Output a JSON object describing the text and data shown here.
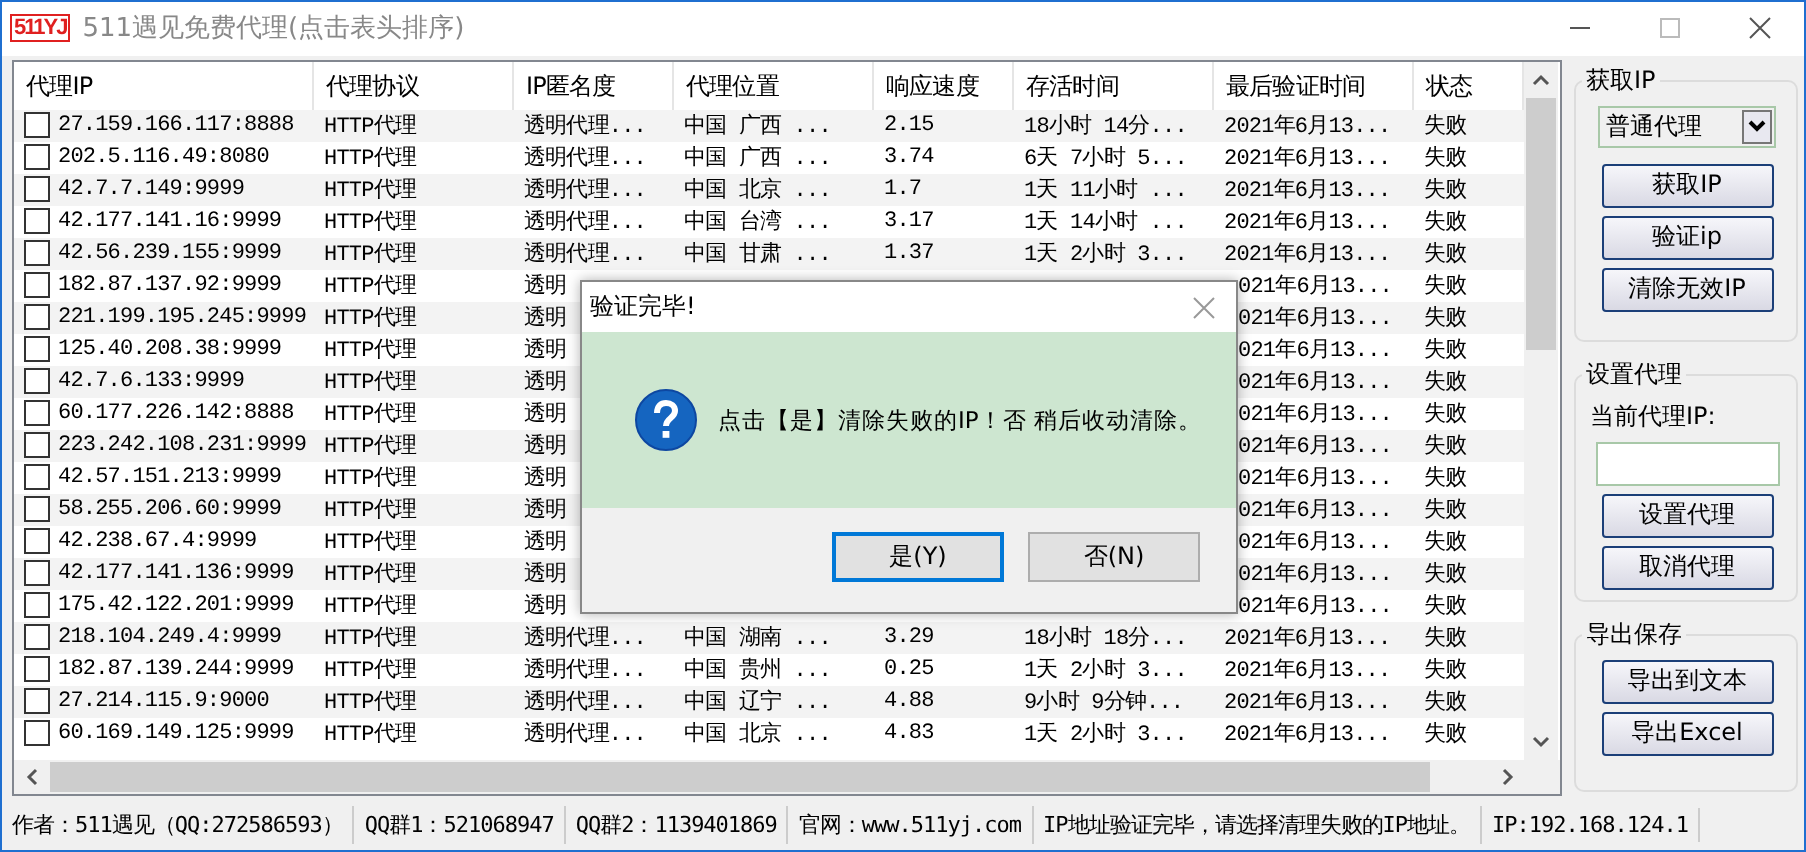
{
  "window": {
    "logo": "511YJ",
    "title": "511遇见免费代理(点击表头排序)"
  },
  "table": {
    "columns": [
      "代理IP",
      "代理协议",
      "IP匿名度",
      "代理位置",
      "响应速度",
      "存活时间",
      "最后验证时间",
      "状态"
    ],
    "rows": [
      {
        "kind": "full",
        "checked": false,
        "ip": "27.159.166.117:8888",
        "protocol": "HTTP代理",
        "anonymity": "透明代理...",
        "location": "中国 广西 ...",
        "speed": "2.15",
        "uptime": "18小时 14分...",
        "last_check": "2021年6月13...",
        "status": "失败"
      },
      {
        "kind": "full",
        "checked": false,
        "ip": "202.5.116.49:8080",
        "protocol": "HTTP代理",
        "anonymity": "透明代理...",
        "location": "中国 广西 ...",
        "speed": "3.74",
        "uptime": "6天 7小时 5...",
        "last_check": "2021年6月13...",
        "status": "失败"
      },
      {
        "kind": "full",
        "checked": false,
        "ip": "42.7.7.149:9999",
        "protocol": "HTTP代理",
        "anonymity": "透明代理...",
        "location": "中国 北京 ...",
        "speed": "1.7",
        "uptime": "1天 11小时 ...",
        "last_check": "2021年6月13...",
        "status": "失败"
      },
      {
        "kind": "full",
        "checked": false,
        "ip": "42.177.141.16:9999",
        "protocol": "HTTP代理",
        "anonymity": "透明代理...",
        "location": "中国 台湾 ...",
        "speed": "3.17",
        "uptime": "1天 14小时 ...",
        "last_check": "2021年6月13...",
        "status": "失败"
      },
      {
        "kind": "full",
        "checked": false,
        "ip": "42.56.239.155:9999",
        "protocol": "HTTP代理",
        "anonymity": "透明代理...",
        "location": "中国 甘肃 ...",
        "speed": "1.37",
        "uptime": "1天 2小时 3...",
        "last_check": "2021年6月13...",
        "status": "失败"
      },
      {
        "kind": "covered",
        "checked": false,
        "ip": "182.87.137.92:9999",
        "protocol": "HTTP代理",
        "anonymity": "透明",
        "last_check": "021年6月13...",
        "status": "失败"
      },
      {
        "kind": "covered",
        "checked": false,
        "ip": "221.199.195.245:9999",
        "protocol": "HTTP代理",
        "anonymity": "透明",
        "last_check": "021年6月13...",
        "status": "失败"
      },
      {
        "kind": "covered",
        "checked": false,
        "ip": "125.40.208.38:9999",
        "protocol": "HTTP代理",
        "anonymity": "透明",
        "last_check": "021年6月13...",
        "status": "失败"
      },
      {
        "kind": "covered",
        "checked": false,
        "ip": "42.7.6.133:9999",
        "protocol": "HTTP代理",
        "anonymity": "透明",
        "last_check": "021年6月13...",
        "status": "失败"
      },
      {
        "kind": "covered",
        "checked": false,
        "ip": "60.177.226.142:8888",
        "protocol": "HTTP代理",
        "anonymity": "透明",
        "last_check": "021年6月13...",
        "status": "失败"
      },
      {
        "kind": "covered",
        "checked": false,
        "ip": "223.242.108.231:9999",
        "protocol": "HTTP代理",
        "anonymity": "透明",
        "last_check": "021年6月13...",
        "status": "失败"
      },
      {
        "kind": "covered",
        "checked": false,
        "ip": "42.57.151.213:9999",
        "protocol": "HTTP代理",
        "anonymity": "透明",
        "last_check": "021年6月13...",
        "status": "失败"
      },
      {
        "kind": "covered",
        "checked": false,
        "ip": "58.255.206.60:9999",
        "protocol": "HTTP代理",
        "anonymity": "透明",
        "last_check": "021年6月13...",
        "status": "失败"
      },
      {
        "kind": "covered",
        "checked": false,
        "ip": "42.238.67.4:9999",
        "protocol": "HTTP代理",
        "anonymity": "透明",
        "last_check": "021年6月13...",
        "status": "失败"
      },
      {
        "kind": "covered",
        "checked": false,
        "ip": "42.177.141.136:9999",
        "protocol": "HTTP代理",
        "anonymity": "透明",
        "last_check": "021年6月13...",
        "status": "失败"
      },
      {
        "kind": "covered",
        "checked": false,
        "ip": "175.42.122.201:9999",
        "protocol": "HTTP代理",
        "anonymity": "透明",
        "last_check": "021年6月13...",
        "status": "失败"
      },
      {
        "kind": "full",
        "checked": false,
        "ip": "218.104.249.4:9999",
        "protocol": "HTTP代理",
        "anonymity": "透明代理...",
        "location": "中国 湖南 ...",
        "speed": "3.29",
        "uptime": "18小时 18分...",
        "last_check": "2021年6月13...",
        "status": "失败"
      },
      {
        "kind": "full",
        "checked": false,
        "ip": "182.87.139.244:9999",
        "protocol": "HTTP代理",
        "anonymity": "透明代理...",
        "location": "中国 贵州 ...",
        "speed": "0.25",
        "uptime": "1天 2小时 3...",
        "last_check": "2021年6月13...",
        "status": "失败"
      },
      {
        "kind": "full",
        "checked": false,
        "ip": "27.214.115.9:9000",
        "protocol": "HTTP代理",
        "anonymity": "透明代理...",
        "location": "中国 辽宁 ...",
        "speed": "4.88",
        "uptime": "9小时 9分钟...",
        "last_check": "2021年6月13...",
        "status": "失败"
      },
      {
        "kind": "full",
        "checked": false,
        "ip": "60.169.149.125:9999",
        "protocol": "HTTP代理",
        "anonymity": "透明代理...",
        "location": "中国 北京 ...",
        "speed": "4.83",
        "uptime": "1天 2小时 3...",
        "last_check": "2021年6月13...",
        "status": "失败"
      }
    ]
  },
  "sidebar": {
    "groups": [
      {
        "title": "获取IP",
        "select": "普通代理",
        "buttons": [
          "获取IP",
          "验证ip",
          "清除无效IP"
        ]
      },
      {
        "title": "设置代理",
        "field_label": "当前代理IP:",
        "buttons": [
          "设置代理",
          "取消代理"
        ]
      },
      {
        "title": "导出保存",
        "buttons": [
          "导出到文本",
          "导出Excel"
        ]
      }
    ]
  },
  "status_bar": [
    "作者：511遇见（QQ:272586593）",
    "QQ群1：521068947",
    "QQ群2：1139401869",
    "官网：www.511yj.com",
    "IP地址验证完毕，请选择清理失败的IP地址。",
    "IP:192.168.124.1"
  ],
  "dialog": {
    "title": "验证完毕!",
    "message": "点击【是】清除失败的IP！否 稍后收动清除。",
    "buttons": [
      {
        "label": "是(Y)",
        "default": true
      },
      {
        "label": "否(N)",
        "default": false
      }
    ]
  }
}
